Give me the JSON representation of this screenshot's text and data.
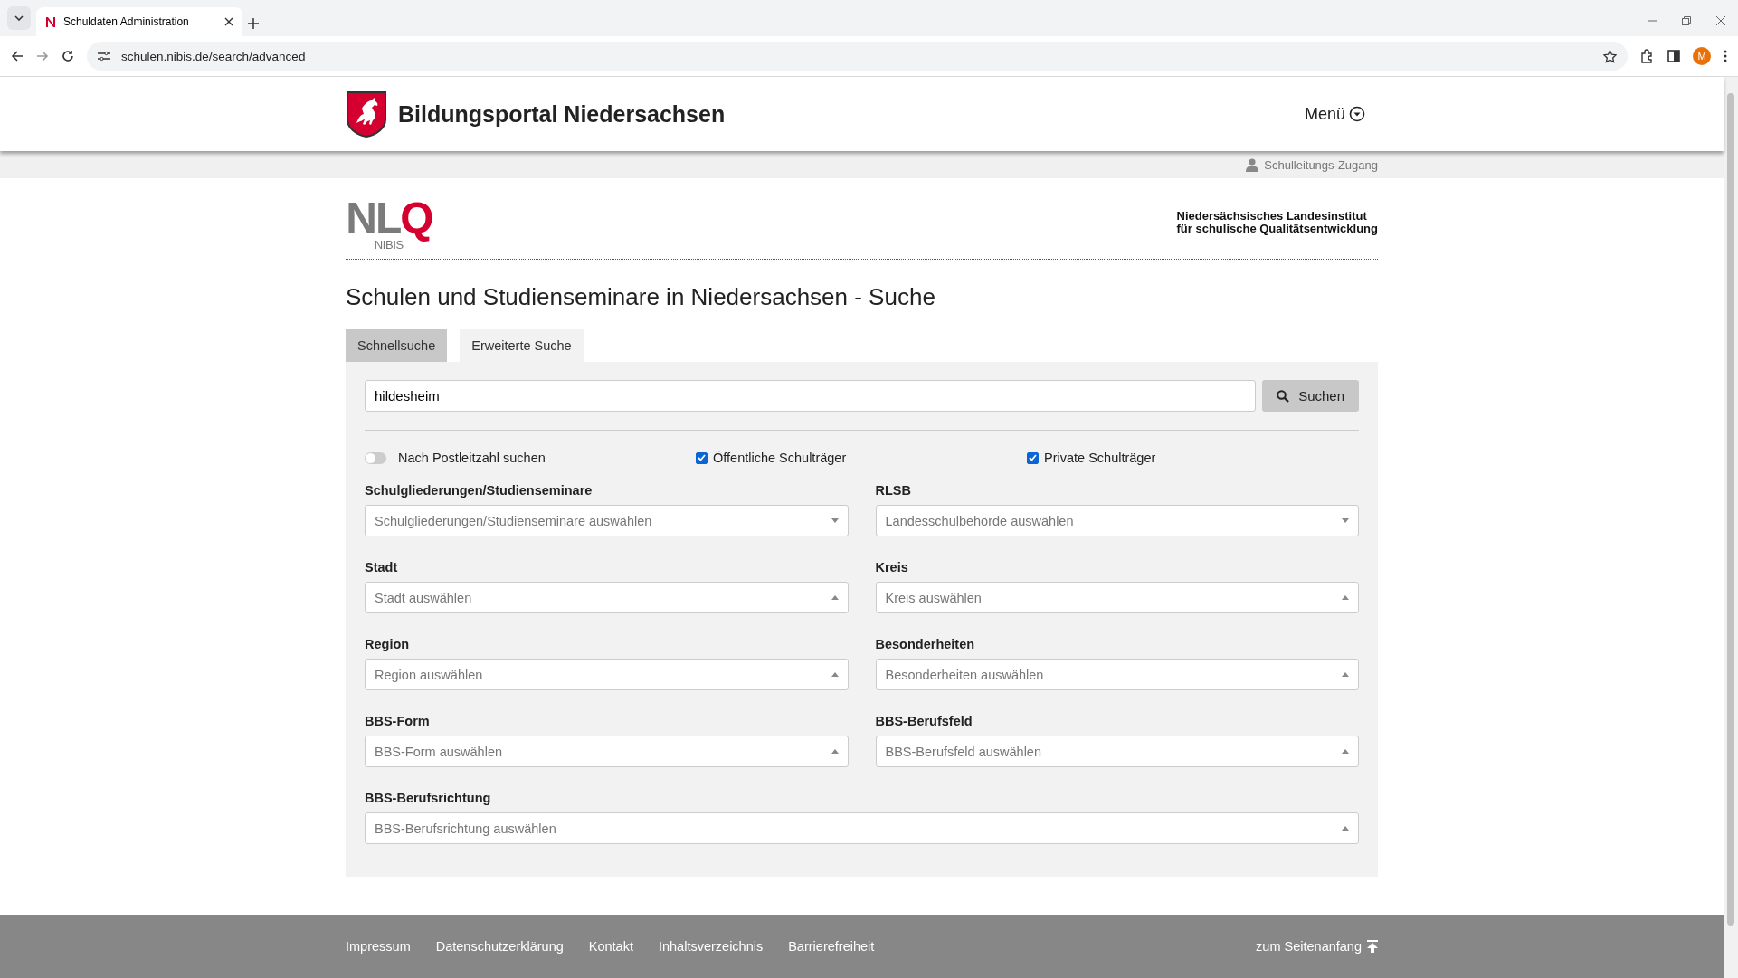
{
  "browser": {
    "tab_title": "Schuldaten Administration",
    "url": "schulen.nibis.de/search/advanced",
    "profile_initial": "M"
  },
  "header": {
    "title": "Bildungsportal Niedersachsen",
    "menu": "Menü"
  },
  "login_link": "Schulleitungs-Zugang",
  "institute": {
    "logo_sub": "NiBiS",
    "logo_main": "NL",
    "logo_accent": "Q",
    "name_lines": [
      "Niedersächsisches Landesinstitut",
      "für schulische Qualitätsentwicklung"
    ]
  },
  "page_title": "Schulen und Studienseminare in Niedersachsen - Suche",
  "tabs": [
    {
      "label": "Schnellsuche",
      "selected": false
    },
    {
      "label": "Erweiterte Suche",
      "selected": true
    }
  ],
  "search": {
    "value": "hildesheim",
    "button": "Suchen"
  },
  "options": [
    {
      "kind": "toggle",
      "label": "Nach Postleitzahl suchen",
      "checked": false
    },
    {
      "kind": "checkbox",
      "label": "Öffentliche Schulträger",
      "checked": true
    },
    {
      "kind": "checkbox",
      "label": "Private Schulträger",
      "checked": true
    }
  ],
  "filters": [
    {
      "label": "Schulgliederungen/Studienseminare",
      "placeholder": "Schulgliederungen/Studienseminare auswählen",
      "expanded": false
    },
    {
      "label": "RLSB",
      "placeholder": "Landesschulbehörde auswählen",
      "expanded": false
    },
    {
      "label": "Stadt",
      "placeholder": "Stadt auswählen",
      "expanded": true
    },
    {
      "label": "Kreis",
      "placeholder": "Kreis auswählen",
      "expanded": true
    },
    {
      "label": "Region",
      "placeholder": "Region auswählen",
      "expanded": true
    },
    {
      "label": "Besonderheiten",
      "placeholder": "Besonderheiten auswählen",
      "expanded": true
    },
    {
      "label": "BBS-Form",
      "placeholder": "BBS-Form auswählen",
      "expanded": true
    },
    {
      "label": "BBS-Berufsfeld",
      "placeholder": "BBS-Berufsfeld auswählen",
      "expanded": true
    },
    {
      "label": "BBS-Berufsrichtung",
      "placeholder": "BBS-Berufsrichtung auswählen",
      "expanded": true
    }
  ],
  "footer": {
    "links": [
      "Impressum",
      "Datenschutzerklärung",
      "Kontakt",
      "Inhaltsverzeichnis",
      "Barrierefreiheit"
    ],
    "top_link": "zum Seitenanfang"
  }
}
